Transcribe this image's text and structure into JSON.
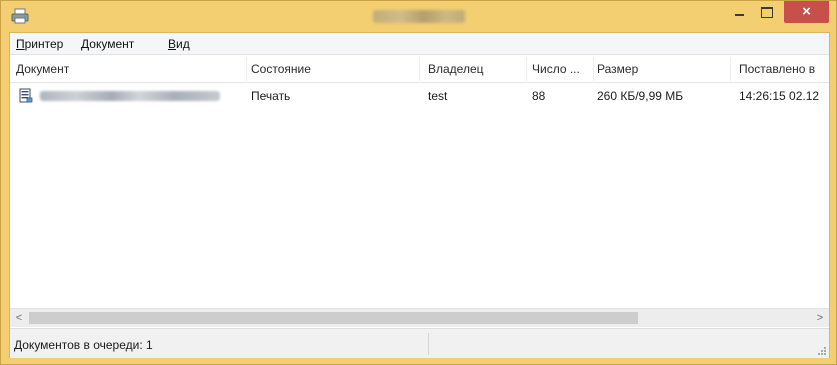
{
  "window": {
    "title": "",
    "controls": {
      "minimize": "",
      "maximize": "",
      "close": "×"
    }
  },
  "menu": [
    {
      "label": "Принтер",
      "accel": "П"
    },
    {
      "label": "Документ",
      "accel": "Д"
    },
    {
      "label": "Вид",
      "accel": "В"
    }
  ],
  "columns": [
    "Документ",
    "Состояние",
    "Владелец",
    "Число ...",
    "Размер",
    "Поставлено в"
  ],
  "rows": [
    {
      "document": "",
      "status": "Печать",
      "owner": "test",
      "pages": "88",
      "size": "260 КБ/9,99 МБ",
      "submitted": "14:26:15  02.12"
    }
  ],
  "scrollbar": {
    "left_arrow": "<",
    "right_arrow": ">",
    "visible_fraction": 0.78
  },
  "status": {
    "text": "Документов в очереди: 1"
  },
  "colors": {
    "frame": "#f3cf72",
    "close": "#c7504a"
  }
}
